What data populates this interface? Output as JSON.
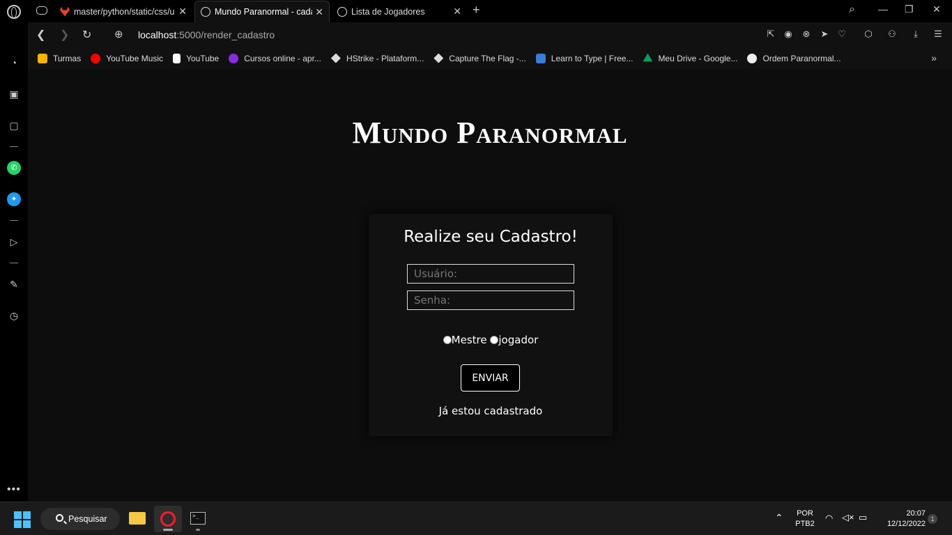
{
  "browser": {
    "tabs": [
      {
        "title": "master/python/static/css/u",
        "favicon": "gitlab-icon",
        "active": false
      },
      {
        "title": "Mundo Paranormal - cadas",
        "favicon": "globe-icon",
        "active": true
      },
      {
        "title": "Lista de Jogadores",
        "favicon": "globe-icon",
        "active": false
      }
    ],
    "url_host": "localhost",
    "url_path": ":5000/render_cadastro",
    "bookmarks": [
      {
        "label": "Turmas",
        "color": "#f4b400"
      },
      {
        "label": "YouTube Music",
        "color": "#ff0000"
      },
      {
        "label": "YouTube",
        "color": "#ffffff"
      },
      {
        "label": "Cursos online - apr...",
        "color": "#8a2be2"
      },
      {
        "label": "HStrike - Plataform...",
        "color": "#dddddd"
      },
      {
        "label": "Capture The Flag -...",
        "color": "#dddddd"
      },
      {
        "label": "Learn to Type | Free...",
        "color": "#3d7bd9"
      },
      {
        "label": "Meu Drive - Google...",
        "color": "#0f9d58"
      },
      {
        "label": "Ordem Paranormal...",
        "color": "#eeeeee"
      }
    ]
  },
  "page": {
    "site_title": "Mundo Paranormal",
    "card_title": "Realize seu Cadastro!",
    "user_placeholder": "Usuário:",
    "pass_placeholder": "Senha:",
    "role_mestre": "Mestre",
    "role_jogador": "jogador",
    "submit_label": "ENVIAR",
    "login_link": "Já estou cadastrado"
  },
  "taskbar": {
    "search_label": "Pesquisar",
    "lang": "POR",
    "layout": "PTB2",
    "time": "20:07",
    "date": "12/12/2022",
    "notifications": "1"
  },
  "colors": {
    "accent_blue": "#4cc2ff",
    "opera_red": "#ff1b2d",
    "page_bg": "#0d0d0d",
    "card_bg": "#111111"
  }
}
